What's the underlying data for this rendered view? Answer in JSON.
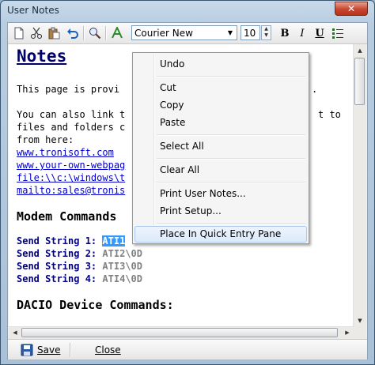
{
  "window": {
    "title": "User Notes",
    "close_glyph": "✕"
  },
  "toolbar": {
    "icons": [
      "new-document-icon",
      "cut-icon",
      "paste-icon",
      "undo-icon",
      "find-icon",
      "font-color-icon"
    ],
    "font_name": "Courier New",
    "font_size": "10",
    "bold_label": "B",
    "italic_label": "I",
    "underline_label": "U"
  },
  "editor": {
    "heading": "Notes",
    "lines": [
      "This page is provi",
      "You can also link t",
      "files and folders c",
      "from here:"
    ],
    "right_fragments": [
      ".",
      "t to"
    ],
    "links": [
      "www.tronisoft.com",
      "www.your-own-webpag",
      "file:\\\\c:\\windows\\t",
      "mailto:sales@tronis"
    ],
    "modem_heading": "Modem Commands",
    "send_rows": [
      {
        "label": "Send String 1:",
        "cmd": "ATI1"
      },
      {
        "label": "Send String 2:",
        "cmd": "ATI2\\0D"
      },
      {
        "label": "Send String 3:",
        "cmd": "ATI3\\0D"
      },
      {
        "label": "Send String 4:",
        "cmd": "ATI4\\0D"
      }
    ],
    "daci_heading": "DACIO Device Commands:"
  },
  "context_menu": {
    "items": [
      {
        "label": "Undo"
      },
      {
        "label": "Cut"
      },
      {
        "label": "Copy"
      },
      {
        "label": "Paste"
      },
      {
        "label": "Select All"
      },
      {
        "label": "Clear All"
      },
      {
        "label": "Print User Notes..."
      },
      {
        "label": "Print Setup..."
      },
      {
        "label": "Place In Quick Entry Pane",
        "highlighted": true
      }
    ]
  },
  "bottom": {
    "save_label": "Save",
    "close_label": "Close"
  }
}
